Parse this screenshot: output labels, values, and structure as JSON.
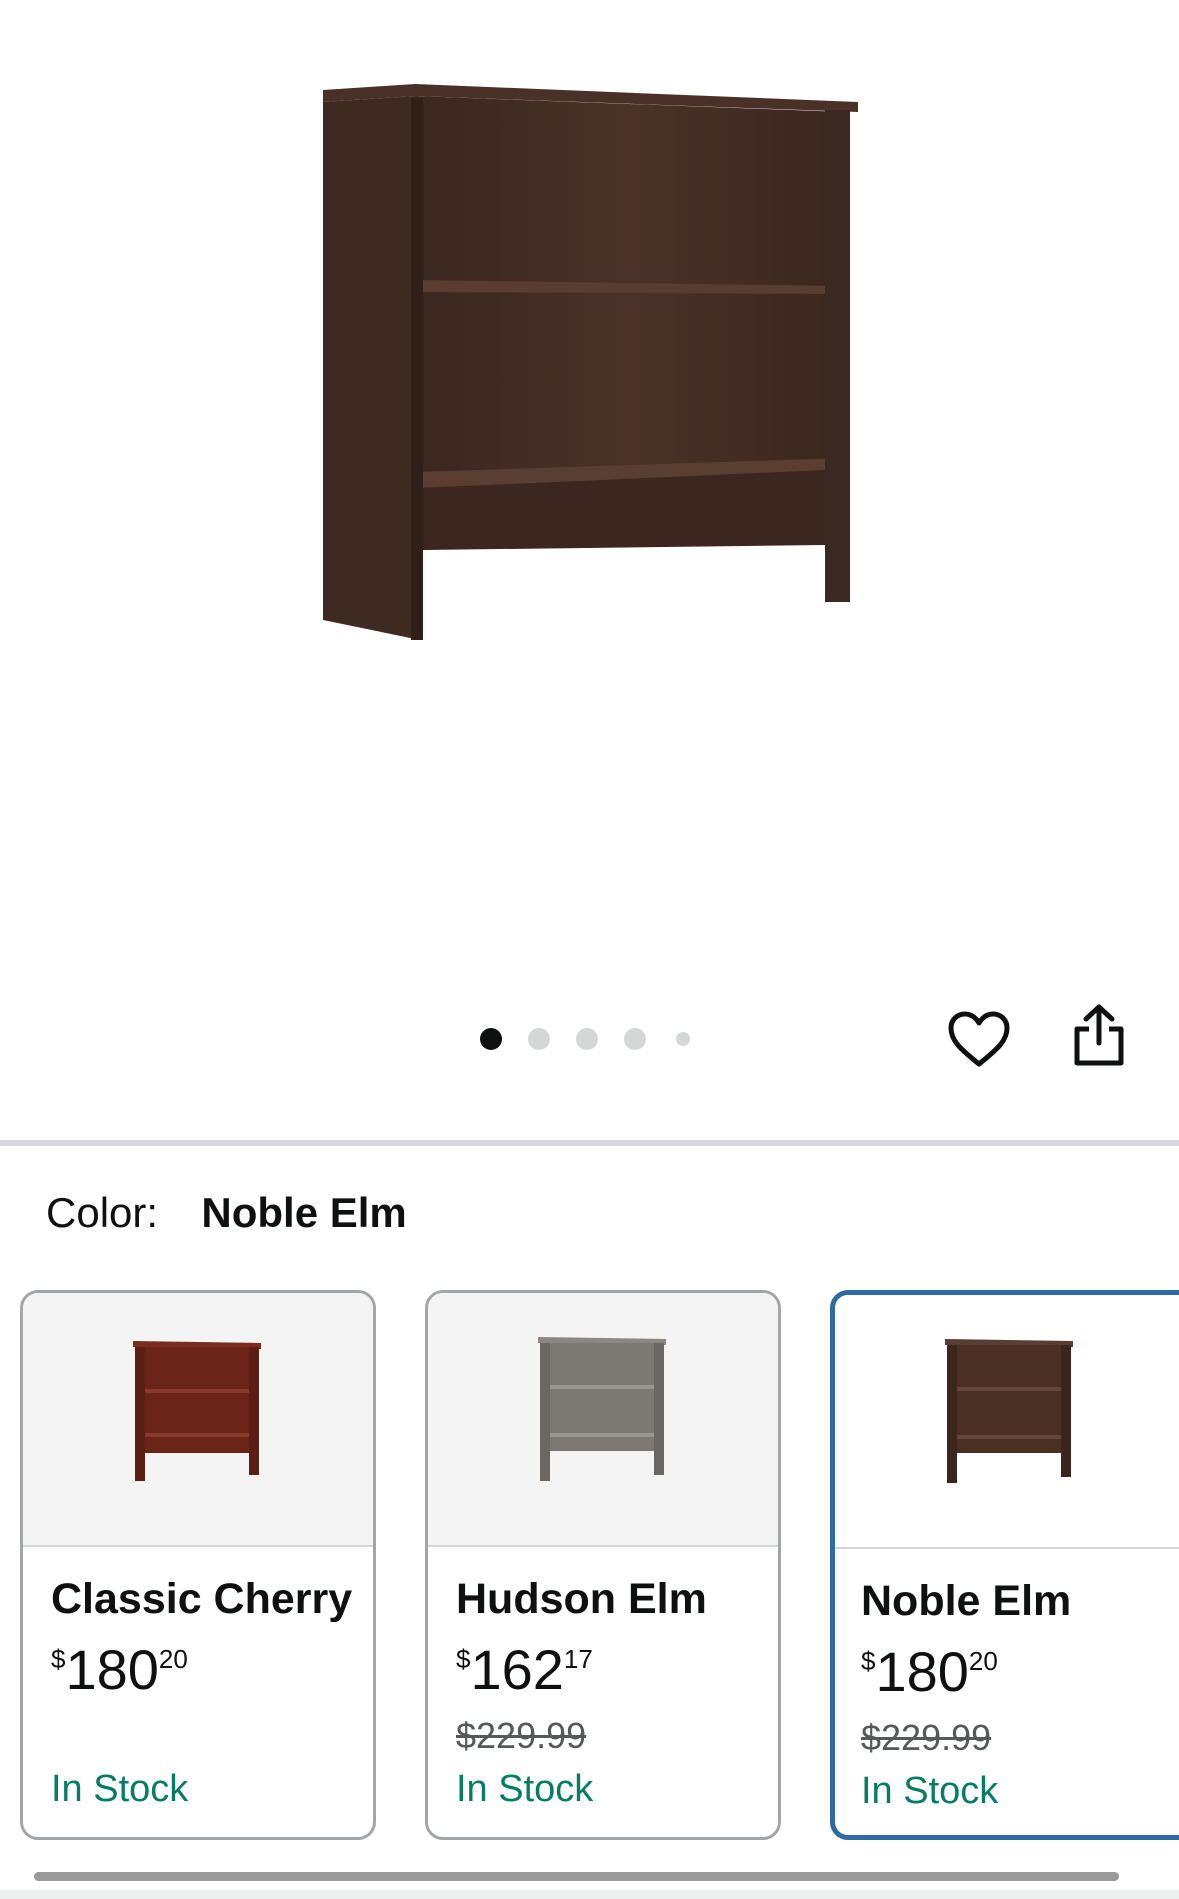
{
  "gallery": {
    "image_count": 5,
    "active_index": 0,
    "actions": {
      "favorite_icon": "heart-icon",
      "share_icon": "share-icon"
    }
  },
  "color_selector": {
    "label": "Color:",
    "selected": "Noble Elm",
    "options": [
      {
        "name": "Classic Cherry",
        "price_currency": "$",
        "price_whole": "180",
        "price_fraction": "20",
        "original_price": "",
        "availability": "In Stock",
        "swatch_color": "#6b2418"
      },
      {
        "name": "Hudson Elm",
        "price_currency": "$",
        "price_whole": "162",
        "price_fraction": "17",
        "original_price": "$229.99",
        "availability": "In Stock",
        "swatch_color": "#7c7874"
      },
      {
        "name": "Noble Elm",
        "price_currency": "$",
        "price_whole": "180",
        "price_fraction": "20",
        "original_price": "$229.99",
        "availability": "In Stock",
        "swatch_color": "#4a3024"
      }
    ]
  },
  "colors": {
    "in_stock": "#067d62",
    "selected_border": "#2f6aa3",
    "product_wood": "#3f2a22"
  }
}
